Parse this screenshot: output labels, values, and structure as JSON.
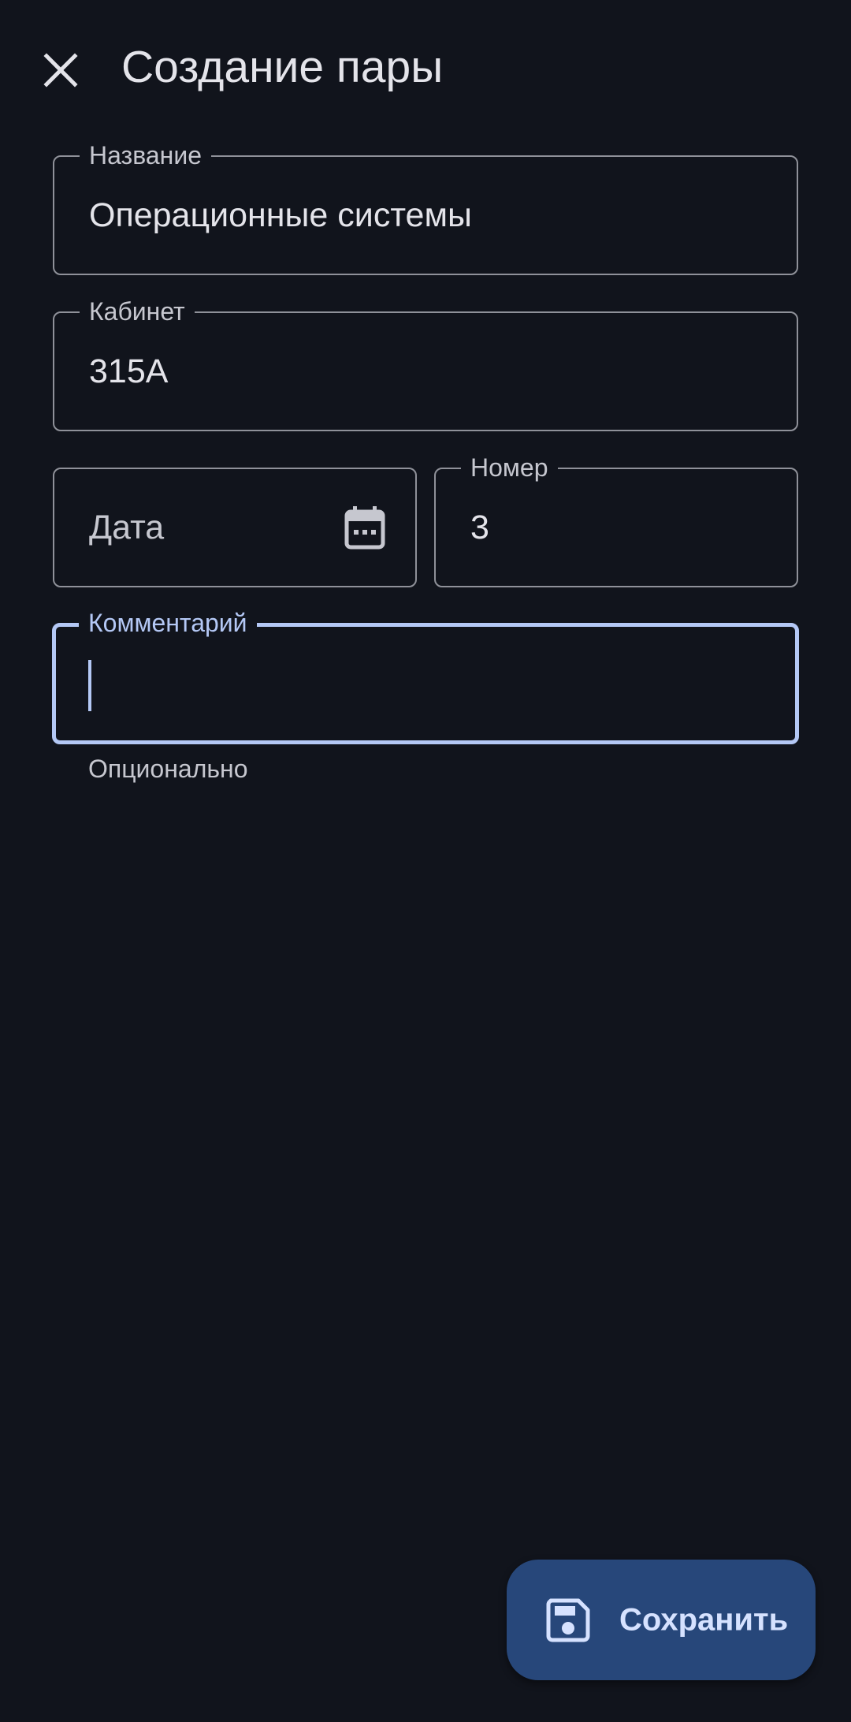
{
  "header": {
    "title": "Создание пары",
    "close_icon": "close-icon"
  },
  "form": {
    "name": {
      "label": "Название",
      "value": "Операционные системы"
    },
    "room": {
      "label": "Кабинет",
      "value": "315A"
    },
    "date": {
      "placeholder": "Дата",
      "icon": "calendar-icon"
    },
    "number": {
      "label": "Номер",
      "value": "3"
    },
    "comment": {
      "label": "Комментарий",
      "value": "",
      "helper": "Опционально"
    }
  },
  "fab": {
    "label": "Сохранить",
    "icon": "save-icon"
  },
  "colors": {
    "background": "#11141c",
    "accent": "#b4c8f5",
    "outline": "#8f9199",
    "fab_background": "#27477a"
  }
}
